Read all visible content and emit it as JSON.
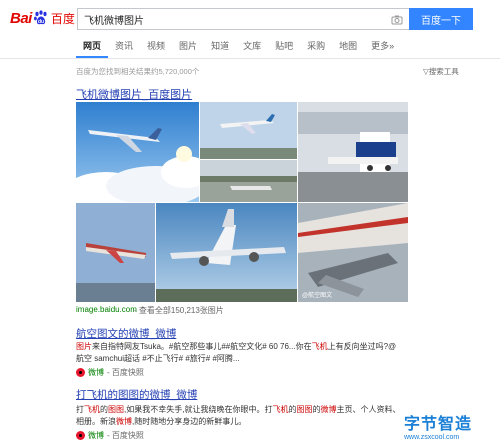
{
  "header": {
    "logo_bai": "Bai",
    "logo_du": "du",
    "logo_cn": "百度",
    "search_value": "飞机微博图片",
    "search_button": "百度一下"
  },
  "tabs": [
    "网页",
    "资讯",
    "视频",
    "图片",
    "知道",
    "文库",
    "贴吧",
    "采购",
    "地图",
    "更多»"
  ],
  "stats": {
    "result_count": "百度为您找到相关结果约5,720,000个",
    "tools": "搜索工具"
  },
  "result1": {
    "title": "飞机微博图片_百度图片",
    "url": "image.baidu.com",
    "view_all": "- 查看全部150,213张图片"
  },
  "result2": {
    "title": "航空图文的微博_微博",
    "line1_a": "图片",
    "line1_b": "来自指特网友Tsuka。#航空那些事儿##航空文化# 60 76...你在",
    "line1_c": "飞机",
    "line1_d": "上有反向坐过吗?@",
    "line2": "航空 samchui超话 #不止飞行# #旅行# #阿腾...",
    "source": "微博",
    "snapshot": "- 百度快照"
  },
  "result3": {
    "title": "打飞机的图图的微博_微博",
    "line1_a": "打",
    "line1_b": "飞机",
    "line1_c": "的",
    "line1_d": "图图",
    "line1_e": ",如果我不幸失手,就让我绕晚在你眼中。打",
    "line1_f": "飞机",
    "line1_g": "的",
    "line1_h": "图图",
    "line1_i": "的",
    "line1_j": "微博",
    "line1_k": "主页、个人资料、",
    "line2": "相册。新浪",
    "line2_b": "微博",
    "line2_c": ",随时随地分享身边的新鲜事儿。",
    "source": "微博",
    "snapshot": "- 百度快照"
  },
  "image_watermark": "@航空图文",
  "watermark": {
    "cn": "字节智造",
    "url": "www.zsxcool.com"
  },
  "colors": {
    "link": "#2440b3",
    "green": "#008000",
    "button": "#3385ff",
    "highlight": "#c00"
  }
}
